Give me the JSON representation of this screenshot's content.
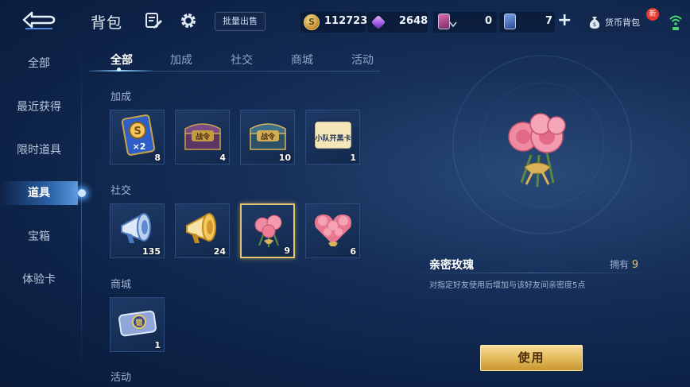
{
  "header": {
    "title": "背包",
    "bulk_sell_label": "批量出售",
    "gold": "112723",
    "gold_symbol": "S",
    "diamond": "2648",
    "pink_cards": "0",
    "blue_cards": "7",
    "plus_label": "+",
    "wallet_label": "货币背包",
    "new_badge": "新"
  },
  "sidebar": {
    "items": [
      {
        "label": "全部"
      },
      {
        "label": "最近获得"
      },
      {
        "label": "限时道具"
      },
      {
        "label": "道具"
      },
      {
        "label": "宝箱"
      },
      {
        "label": "体验卡"
      }
    ],
    "active_index": 3
  },
  "tabs": [
    {
      "label": "全部"
    },
    {
      "label": "加成"
    },
    {
      "label": "社交"
    },
    {
      "label": "商城"
    },
    {
      "label": "活动"
    }
  ],
  "sections": {
    "boost": {
      "title": "加成",
      "items": [
        {
          "count": "8",
          "icon": "double-gold-card-icon",
          "art_text": "×2"
        },
        {
          "count": "4",
          "icon": "battle-pass-chest-icon",
          "art_text": "战令"
        },
        {
          "count": "10",
          "icon": "battle-pass-chest-icon",
          "art_text": "战令"
        },
        {
          "count": "1",
          "icon": "squad-card-icon",
          "art_text": "小队开黑卡"
        }
      ]
    },
    "social": {
      "title": "社交",
      "items": [
        {
          "count": "135",
          "icon": "megaphone-blue-icon"
        },
        {
          "count": "24",
          "icon": "megaphone-gold-icon"
        },
        {
          "count": "9",
          "icon": "rose-bouquet-icon"
        },
        {
          "count": "6",
          "icon": "heart-rose-bouquet-icon"
        }
      ]
    },
    "shop": {
      "title": "商城",
      "items": [
        {
          "count": "1",
          "icon": "coupon-icon",
          "art_text": "锟"
        }
      ]
    },
    "event": {
      "title": "活动"
    }
  },
  "detail": {
    "name": "亲密玫瑰",
    "own_label": "拥有",
    "own_count": "9",
    "description": "对指定好友使用后增加与该好友间亲密度5点",
    "use_label": "使用"
  },
  "colors": {
    "accent_gold": "#e5c46a",
    "active_blue": "#5aa7ff",
    "background": "#0d2247"
  }
}
